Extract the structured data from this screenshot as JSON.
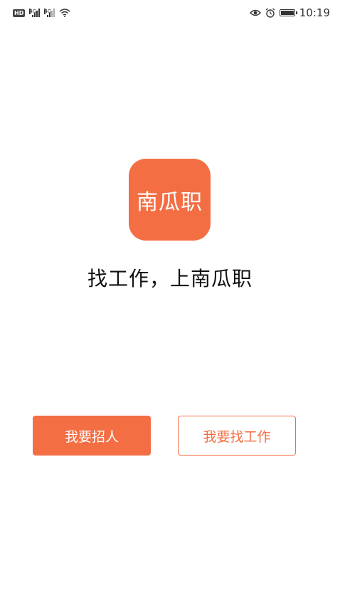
{
  "status_bar": {
    "hd": "HD",
    "network1": "4G",
    "network2": "4G",
    "time": "10:19"
  },
  "logo": {
    "text": "南瓜职",
    "color": "#f46e43"
  },
  "slogan": "找工作，上南瓜职",
  "buttons": {
    "recruit": "我要招人",
    "find_job": "我要找工作"
  },
  "colors": {
    "accent": "#f46e43"
  }
}
